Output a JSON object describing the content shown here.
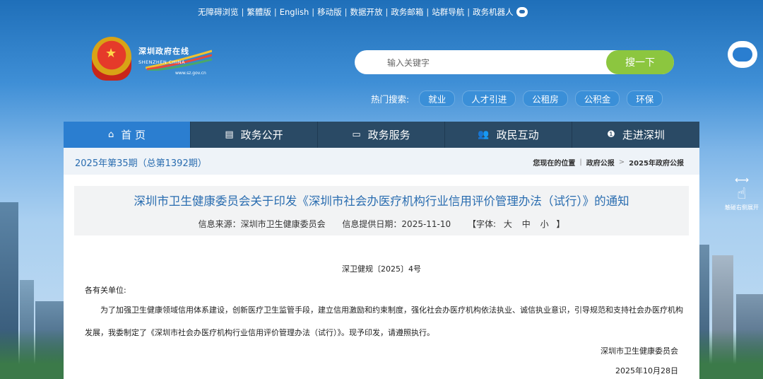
{
  "top_links": [
    "无障碍浏览",
    "繁體版",
    "English",
    "移动版",
    "数据开放",
    "政务邮箱",
    "站群导航",
    "政务机器人"
  ],
  "logo": {
    "title": "深圳政府在线",
    "en": "SHENZHEN CHINA",
    "url": "www.sz.gov.cn"
  },
  "search": {
    "placeholder": "输入关键字",
    "button": "搜一下"
  },
  "hot": {
    "label": "热门搜索:",
    "tags": [
      "就业",
      "人才引进",
      "公租房",
      "公积金",
      "环保"
    ]
  },
  "side": {
    "swipe_hint": "触碰右侧展开"
  },
  "nav": [
    {
      "label": "首 页",
      "icon": "home-icon"
    },
    {
      "label": "政务公开",
      "icon": "news-icon"
    },
    {
      "label": "政务服务",
      "icon": "monitor-icon"
    },
    {
      "label": "政民互动",
      "icon": "users-icon"
    },
    {
      "label": "走进深圳",
      "icon": "info-icon"
    }
  ],
  "issue": "2025年第35期（总第1392期）",
  "breadcrumb": {
    "prefix": "您现在的位置",
    "items": [
      "政府公报",
      "2025年政府公报"
    ],
    "sep": ">"
  },
  "doc": {
    "title": "深圳市卫生健康委员会关于印发《深圳市社会办医疗机构行业信用评价管理办法（试行）》的通知",
    "source_label": "信息来源：深圳市卫生健康委员会",
    "date_label": "信息提供日期：2025-11-10",
    "font_label": "【字体:",
    "font_sizes": [
      "大",
      "中",
      "小"
    ],
    "font_end": "】",
    "doc_no": "深卫健规〔2025〕4号",
    "salutation": "各有关单位:",
    "body": "为了加强卫生健康领域信用体系建设，创新医疗卫生监管手段，建立信用激励和约束制度，强化社会办医疗机构依法执业、诚信执业意识，引导规范和支持社会办医疗机构发展，我委制定了《深圳市社会办医疗机构行业信用评价管理办法（试行）》。现予印发，请遵照执行。",
    "signature": "深圳市卫生健康委员会",
    "signed_date": "2025年10月28日"
  },
  "colors": {
    "nav_active": "#2b7ed0",
    "nav_bg": "#2a4a65",
    "link": "#2a6db0",
    "search_btn": "#8cc63f"
  }
}
